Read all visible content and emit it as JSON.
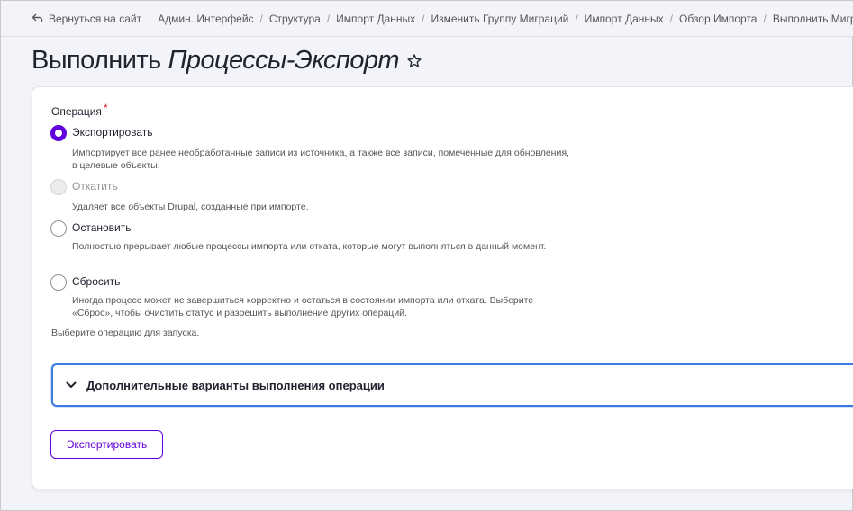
{
  "breadcrumb": {
    "back_label": "Вернуться на сайт",
    "items": [
      "Админ. Интерфейс",
      "Структура",
      "Импорт Данных",
      "Изменить Группу Миграций",
      "Импорт Данных",
      "Обзор Импорта",
      "Выполнить Миграцию"
    ]
  },
  "title": {
    "prefix": "Выполнить",
    "name": "Процессы-Экспорт"
  },
  "form": {
    "operation_label": "Операция",
    "required_mark": "*",
    "options": [
      {
        "label": "Экспортировать",
        "description": "Импортирует все ранее необработанные записи из источника, а также все записи, помеченные для обновления, в целевые объекты.",
        "checked": true,
        "disabled": false
      },
      {
        "label": "Откатить",
        "description": "Удаляет все объекты Drupal, созданные при импорте.",
        "checked": false,
        "disabled": true
      },
      {
        "label": "Остановить",
        "description": "Полностью прерывает любые процессы импорта или отката, которые могут выполняться в данный момент.",
        "checked": false,
        "disabled": false
      },
      {
        "label": "Сбросить",
        "description": "Иногда процесс может не завершиться корректно и остаться в состоянии импорта или отката. Выберите «Сброс», чтобы очистить статус и разрешить выполнение других операций.",
        "checked": false,
        "disabled": false
      }
    ],
    "help_text": "Выберите операцию для запуска.",
    "details_summary": "Дополнительные варианты выполнения операции",
    "submit_label": "Экспортировать"
  },
  "colors": {
    "accent": "#6000dd",
    "focus": "#3c7be0",
    "required": "#d72222"
  },
  "icons": {
    "back": "arrow-return-left-icon",
    "favorite": "star-outline-icon",
    "details_toggle": "chevron-down-icon"
  }
}
